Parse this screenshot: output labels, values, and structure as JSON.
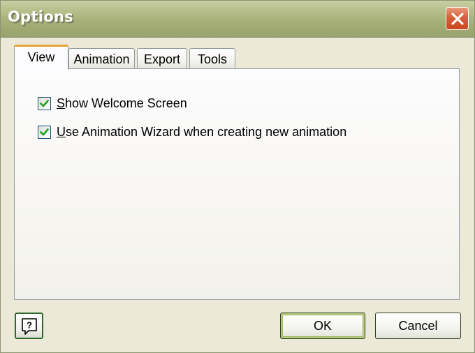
{
  "window": {
    "title": "Options"
  },
  "tabs": [
    {
      "label": "View",
      "active": true
    },
    {
      "label": "Animation",
      "active": false
    },
    {
      "label": "Export",
      "active": false
    },
    {
      "label": "Tools",
      "active": false
    }
  ],
  "view_panel": {
    "checkboxes": [
      {
        "label_underlined": "S",
        "label_rest": "how Welcome Screen",
        "checked": true
      },
      {
        "label_underlined": "U",
        "label_rest": "se Animation Wizard when creating new animation",
        "checked": true
      }
    ]
  },
  "buttons": {
    "ok_label": "OK",
    "cancel_label": "Cancel",
    "help_icon": "help-question-icon"
  },
  "colors": {
    "titlebar": "#a8b07a",
    "active_tab_accent": "#e7a33a",
    "checkmark": "#21a121",
    "close_button": "#d8603a"
  }
}
